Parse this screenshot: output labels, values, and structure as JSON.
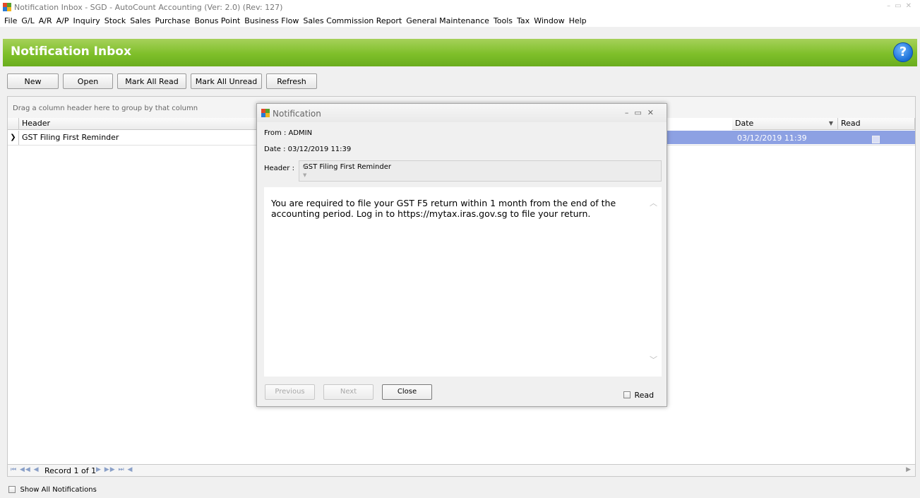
{
  "window": {
    "title": "Notification Inbox - SGD - AutoCount Accounting (Ver: 2.0) (Rev: 127)"
  },
  "menu": [
    "File",
    "G/L",
    "A/R",
    "A/P",
    "Inquiry",
    "Stock",
    "Sales",
    "Purchase",
    "Bonus Point",
    "Business Flow",
    "Sales Commission Report",
    "General Maintenance",
    "Tools",
    "Tax",
    "Window",
    "Help"
  ],
  "banner": {
    "title": "Notification Inbox",
    "help_glyph": "?"
  },
  "toolbar": {
    "new": "New",
    "open": "Open",
    "mark_all_read": "Mark All Read",
    "mark_all_unread": "Mark All Unread",
    "refresh": "Refresh"
  },
  "grid": {
    "group_panel_hint": "Drag a column header here to group by that column",
    "columns": {
      "header": "Header",
      "date": "Date",
      "read": "Read"
    },
    "rows": [
      {
        "header": "GST Filing First Reminder",
        "date": "03/12/2019 11:39",
        "read": false
      }
    ]
  },
  "navigator": {
    "record_text": "Record 1 of 1"
  },
  "footer": {
    "show_all": "Show All Notifications"
  },
  "dialog": {
    "title": "Notification",
    "from": "From : ADMIN",
    "date": "Date : 03/12/2019 11:39",
    "header_label": "Header :",
    "header_value": "GST Filing First Reminder",
    "body": "You are required to file your GST F5 return within 1 month from the end of the accounting period. Log in to https://mytax.iras.gov.sg to file your return.",
    "previous": "Previous",
    "next": "Next",
    "close": "Close",
    "read_label": "Read"
  },
  "colors": {
    "banner_green": "#7fbf2a",
    "selected_row": "#8da1e3"
  }
}
